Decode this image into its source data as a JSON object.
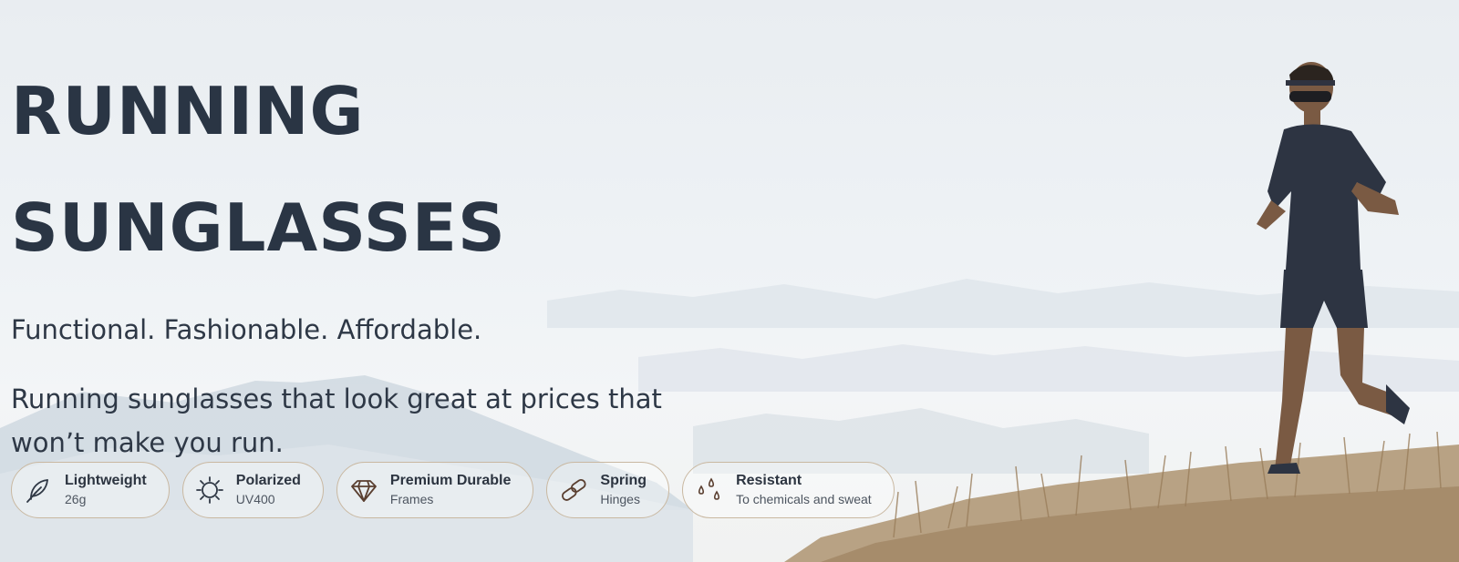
{
  "hero": {
    "title_line1": "RUNNING",
    "title_line2": "SUNGLASSES",
    "tagline": "Functional. Fashionable. Affordable.",
    "description": "Running sunglasses that look great at prices that won’t make you run."
  },
  "features": [
    {
      "icon": "feather-icon",
      "label": "Lightweight",
      "sub": "26g"
    },
    {
      "icon": "sun-icon",
      "label": "Polarized",
      "sub": "UV400"
    },
    {
      "icon": "diamond-icon",
      "label": "Premium Durable",
      "sub": "Frames"
    },
    {
      "icon": "link-icon",
      "label": "Spring",
      "sub": "Hinges"
    },
    {
      "icon": "droplets-icon",
      "label": "Resistant",
      "sub": "To chemicals and sweat"
    }
  ],
  "colors": {
    "heading": "#2a3544",
    "pill_border": "#c9b8a1",
    "accent_brown": "#7a5a43"
  }
}
